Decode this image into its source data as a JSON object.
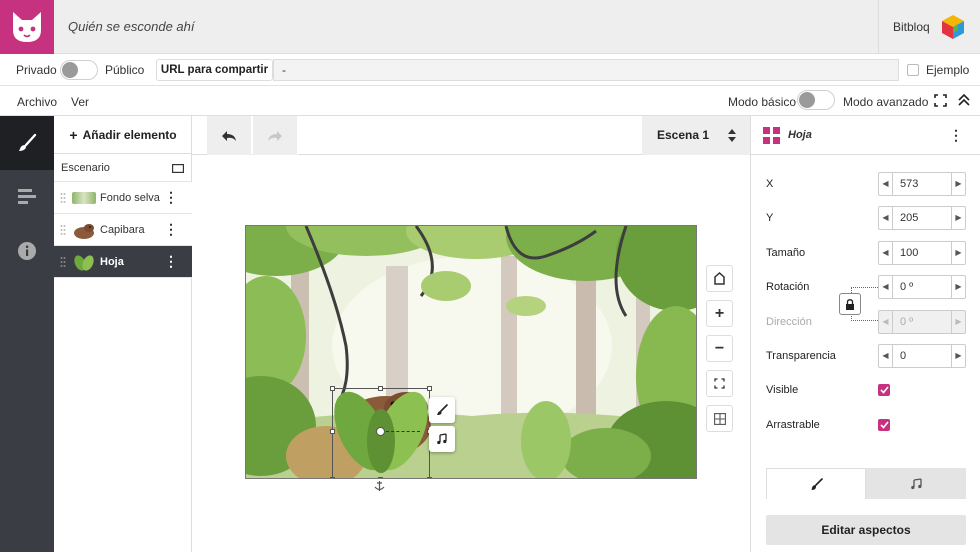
{
  "header": {
    "project_title": "Quién se esconde ahí",
    "brand_label": "Bitbloq",
    "logo_icon": "cat-face-icon",
    "accent_color": "#c6327f"
  },
  "share": {
    "private_label": "Privado",
    "public_label": "Público",
    "url_button_label": "URL para compartir",
    "url_value": "-",
    "example_label": "Ejemplo"
  },
  "menu": {
    "items": [
      "Archivo",
      "Ver"
    ],
    "basic_mode_label": "Modo básico",
    "advanced_mode_label": "Modo avanzado"
  },
  "elements": {
    "add_label": "Añadir elemento",
    "stage_label": "Escenario",
    "items": [
      {
        "name": "Fondo selva"
      },
      {
        "name": "Capibara"
      },
      {
        "name": "Hoja"
      }
    ],
    "selected": "Hoja"
  },
  "canvas": {
    "scene_label": "Escena 1"
  },
  "properties": {
    "title": "Hoja",
    "fields": {
      "x": {
        "label": "X",
        "value": "573"
      },
      "y": {
        "label": "Y",
        "value": "205"
      },
      "size": {
        "label": "Tamaño",
        "value": "100"
      },
      "rotation": {
        "label": "Rotación",
        "value": "0 º"
      },
      "direction": {
        "label": "Dirección",
        "value": "0 º"
      },
      "transparency": {
        "label": "Transparencia",
        "value": "0"
      },
      "visible": {
        "label": "Visible",
        "checked": true
      },
      "draggable": {
        "label": "Arrastrable",
        "checked": true
      }
    },
    "edit_button": "Editar aspectos"
  }
}
